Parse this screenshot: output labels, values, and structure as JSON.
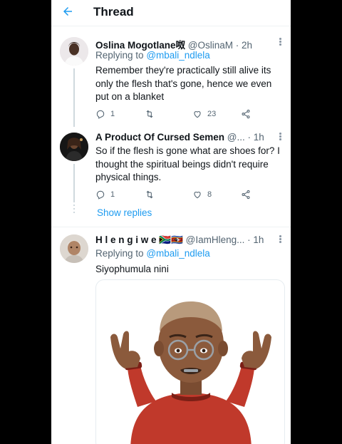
{
  "header": {
    "title": "Thread"
  },
  "tweets": [
    {
      "name": "Oslina Mogotlane",
      "name_suffix": "呶",
      "handle": "@OslinaM",
      "time": "· 2h",
      "replying_label": "Replying to",
      "replying_to": "@mbali_ndlela",
      "text": "Remember they're practically still alive its only the flesh that's gone, hence we even put on a blanket",
      "replies": "1",
      "retweets": "",
      "likes": "23"
    },
    {
      "name": "A Product Of Cursed Semen",
      "handle": "@...",
      "time": "· 1h",
      "text": "So if the flesh is gone what are shoes for? I thought the spiritual beings didn't require physical things.",
      "replies": "1",
      "retweets": "",
      "likes": "8"
    },
    {
      "name": "H l e n g i w e",
      "name_emoji": "🇿🇦🇸🇿",
      "handle": "@IamHleng...",
      "time": "· 1h",
      "replying_label": "Replying to",
      "replying_to": "@mbali_ndlela",
      "text": "Siyophumula nini"
    }
  ],
  "show_replies": "Show replies",
  "colors": {
    "accent": "#1d9bf0",
    "secondary_text": "#536471",
    "line": "#cfd9de"
  },
  "icons": [
    "back-arrow-icon",
    "more-icon",
    "reply-icon",
    "retweet-icon",
    "like-icon",
    "share-icon"
  ]
}
